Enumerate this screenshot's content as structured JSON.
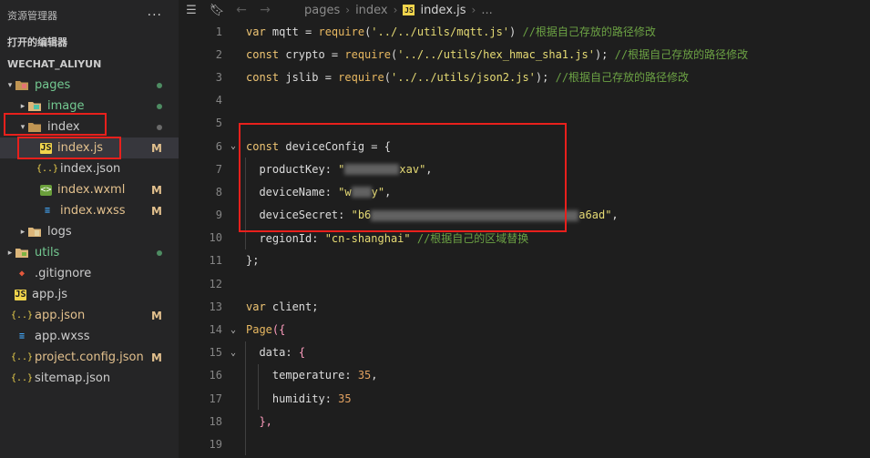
{
  "sidebar": {
    "title": "资源管理器",
    "more": "···",
    "open_editors": "打开的编辑器",
    "project": "WECHAT_ALIYUN",
    "items": [
      {
        "label": "pages",
        "type": "folder",
        "expanded": true,
        "depth": 0,
        "status": "dot",
        "color": "#73c991"
      },
      {
        "label": "image",
        "type": "folder",
        "expanded": false,
        "depth": 1,
        "status": "dot",
        "color": "#73c991"
      },
      {
        "label": "index",
        "type": "folder",
        "expanded": true,
        "depth": 1,
        "status": "dot",
        "color": "#cccccc"
      },
      {
        "label": "index.js",
        "type": "js",
        "depth": 2,
        "status": "M",
        "color": "#e2c08d",
        "selected": true
      },
      {
        "label": "index.json",
        "type": "json",
        "depth": 2,
        "status": "",
        "color": "#cccccc"
      },
      {
        "label": "index.wxml",
        "type": "wxml",
        "depth": 2,
        "status": "M",
        "color": "#e2c08d"
      },
      {
        "label": "index.wxss",
        "type": "wxss",
        "depth": 2,
        "status": "M",
        "color": "#e2c08d"
      },
      {
        "label": "logs",
        "type": "folder",
        "expanded": false,
        "depth": 1,
        "status": "",
        "color": "#cccccc"
      },
      {
        "label": "utils",
        "type": "folder",
        "expanded": false,
        "depth": 0,
        "status": "dot",
        "color": "#73c991"
      },
      {
        "label": ".gitignore",
        "type": "git",
        "depth": 0,
        "status": "",
        "color": "#cccccc"
      },
      {
        "label": "app.js",
        "type": "js",
        "depth": 0,
        "status": "",
        "color": "#cccccc"
      },
      {
        "label": "app.json",
        "type": "json",
        "depth": 0,
        "status": "M",
        "color": "#e2c08d"
      },
      {
        "label": "app.wxss",
        "type": "wxss",
        "depth": 0,
        "status": "",
        "color": "#cccccc"
      },
      {
        "label": "project.config.json",
        "type": "json",
        "depth": 0,
        "status": "M",
        "color": "#e2c08d"
      },
      {
        "label": "sitemap.json",
        "type": "json",
        "depth": 0,
        "status": "",
        "color": "#cccccc"
      }
    ]
  },
  "editor": {
    "breadcrumb": [
      "pages",
      "index",
      "index.js",
      "..."
    ],
    "lines": [
      {
        "n": "1",
        "code": "var mqtt = require('../../utils/mqtt.js') //根据自己存放的路径修改"
      },
      {
        "n": "2",
        "code": "const crypto = require('../../utils/hex_hmac_sha1.js'); //根据自己存放的路径修改"
      },
      {
        "n": "3",
        "code": "const jslib = require('../../utils/json2.js'); //根据自己存放的路径修改"
      },
      {
        "n": "4",
        "code": ""
      },
      {
        "n": "5",
        "code": ""
      },
      {
        "n": "6",
        "code": "const deviceConfig = {"
      },
      {
        "n": "7",
        "code": "  productKey: \"xav\","
      },
      {
        "n": "8",
        "code": "  deviceName: \"wy\","
      },
      {
        "n": "9",
        "code": "  deviceSecret: \"b6a6ad\","
      },
      {
        "n": "10",
        "code": "  regionId: \"cn-shanghai\" //根据自己的区域替换"
      },
      {
        "n": "11",
        "code": "};"
      },
      {
        "n": "12",
        "code": ""
      },
      {
        "n": "13",
        "code": "var client;"
      },
      {
        "n": "14",
        "code": "Page({"
      },
      {
        "n": "15",
        "code": "  data: {"
      },
      {
        "n": "16",
        "code": "    temperature: 35,"
      },
      {
        "n": "17",
        "code": "    humidity: 35"
      },
      {
        "n": "18",
        "code": "  },"
      },
      {
        "n": "19",
        "code": ""
      }
    ],
    "tokens": {
      "l1": [
        "var",
        " mqtt = ",
        "require",
        "(",
        "'../../utils/mqtt.js'",
        ") ",
        "//根据自己存放的路径修改"
      ],
      "l2": [
        "const",
        " crypto = ",
        "require",
        "(",
        "'../../utils/hex_hmac_sha1.js'",
        "); ",
        "//根据自己存放的路径修改"
      ],
      "l3": [
        "const",
        " jslib = ",
        "require",
        "(",
        "'../../utils/json2.js'",
        "); ",
        "//根据自己存放的路径修改"
      ],
      "l6": [
        "const",
        " deviceConfig = {"
      ],
      "l7": [
        "productKey: ",
        "\"",
        "xav\"",
        ","
      ],
      "l8": [
        "deviceName: ",
        "\"w",
        "y\"",
        ","
      ],
      "l9": [
        "deviceSecret: ",
        "\"b6",
        "a6ad\"",
        ","
      ],
      "l10": [
        "regionId: ",
        "\"cn-shanghai\"",
        " //根据自己的区域替换"
      ],
      "l11": [
        "};"
      ],
      "l13": [
        "var",
        " client;"
      ],
      "l14": [
        "Page",
        "({"
      ],
      "l15": [
        "data: ",
        "{"
      ],
      "l16": [
        "temperature: ",
        "35",
        ","
      ],
      "l17": [
        "humidity: ",
        "35"
      ],
      "l18": [
        "},"
      ]
    }
  },
  "colors": {
    "sidebar_bg": "#252526",
    "editor_bg": "#1e1e1e",
    "highlight_box": "#e8201c",
    "modified": "#e2c08d",
    "untracked": "#73c991"
  }
}
